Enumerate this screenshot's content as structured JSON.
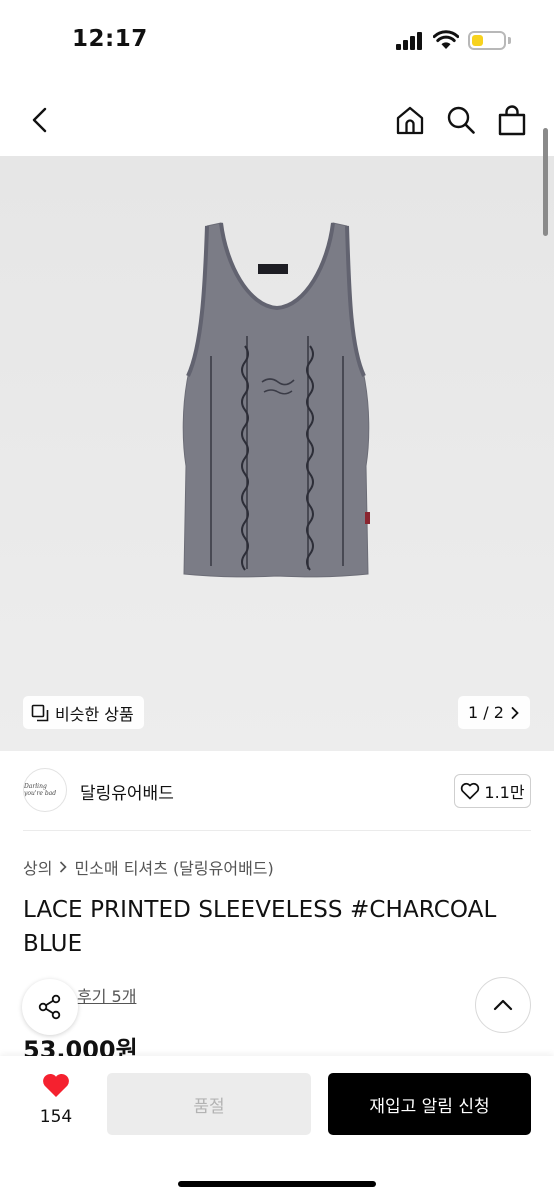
{
  "status_bar": {
    "time": "12:17",
    "battery_level": 0.35
  },
  "nav": {
    "icons": [
      "back-icon",
      "home-icon",
      "search-icon",
      "shopping-bag-icon"
    ]
  },
  "image": {
    "product_alt": "charcoal blue lace sleeveless top",
    "similar_label": "비슷한 상품",
    "page_indicator": "1 / 2"
  },
  "brand": {
    "logo_text": "Darling you're bad",
    "name": "달링유어배드",
    "likes": "1.1만"
  },
  "breadcrumb": {
    "category": "상의",
    "subcategory": "민소매 티셔츠 (달링유어배드)"
  },
  "product": {
    "title": "LACE PRINTED SLEEVELESS #CHARCOAL BLUE",
    "reviews": "후기 5개",
    "price": "53,000원"
  },
  "bottom_bar": {
    "wish_count": "154",
    "soldout_label": "품절",
    "restock_label": "재입고 알림 신청"
  },
  "colors": {
    "accent_red": "#f5212f",
    "battery_yellow": "#f7d21e",
    "garment": "#7b7c86"
  }
}
